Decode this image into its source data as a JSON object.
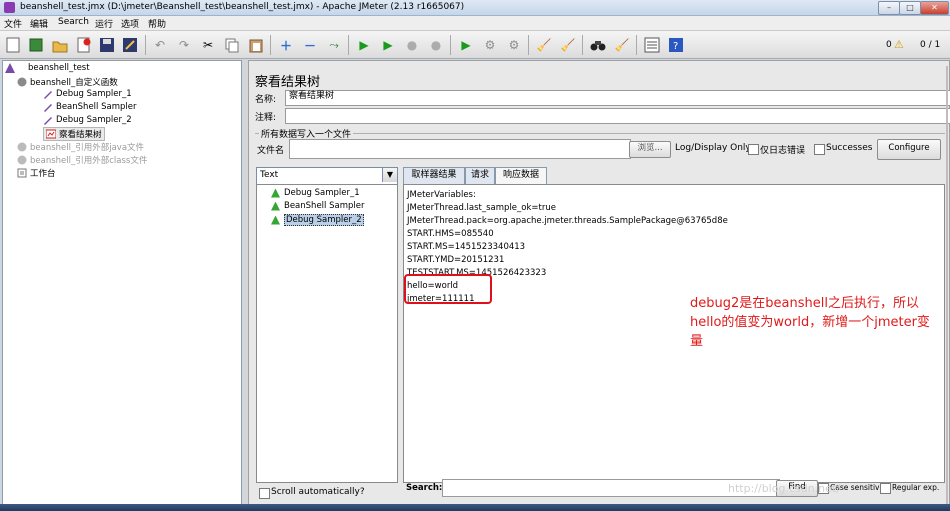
{
  "window": {
    "title": "beanshell_test.jmx (D:\\jmeter\\Beanshell_test\\beanshell_test.jmx) - Apache JMeter (2.13 r1665067)",
    "min_glyph": "–",
    "max_glyph": "□",
    "close_glyph": "✕"
  },
  "menu": [
    "文件",
    "编辑",
    "Search",
    "运行",
    "选项",
    "帮助"
  ],
  "toolbar": {
    "error_count": "0",
    "thread_count": "0 / 1"
  },
  "tree": {
    "items": [
      {
        "label": "beanshell_test",
        "grey": false
      },
      {
        "label": "beanshell_自定义函数",
        "grey": false
      },
      {
        "label": "Debug Sampler_1",
        "grey": false
      },
      {
        "label": "BeanShell Sampler",
        "grey": false
      },
      {
        "label": "Debug Sampler_2",
        "grey": false
      },
      {
        "label": "察看结果树",
        "grey": false
      },
      {
        "label": "beanshell_引用外部java文件",
        "grey": true
      },
      {
        "label": "beanshell_引用外部class文件",
        "grey": true
      },
      {
        "label": "工作台",
        "grey": false
      }
    ]
  },
  "panel": {
    "title": "察看结果树",
    "name_label": "名称:",
    "name_value": "察看结果树",
    "comment_label": "注释:",
    "comment_value": "",
    "group_label": "所有数据写入一个文件",
    "filename_label": "文件名",
    "filename_value": "",
    "browse_label": "浏览...",
    "log_display_label": "Log/Display Only:",
    "errors_only_label": "仅日志错误",
    "successes_label": "Successes",
    "configure_label": "Configure"
  },
  "results": {
    "renderer": "Text",
    "items": [
      "Debug Sampler_1",
      "BeanShell Sampler",
      "Debug Sampler_2"
    ],
    "selected": "Debug Sampler_2",
    "scroll_label": "Scroll automatically?"
  },
  "tabs": [
    "取样器结果",
    "请求",
    "响应数据"
  ],
  "response_lines": [
    "JMeterVariables:",
    "JMeterThread.last_sample_ok=true",
    "JMeterThread.pack=org.apache.jmeter.threads.SamplePackage@63765d8e",
    "START.HMS=085540",
    "START.MS=1451523340413",
    "START.YMD=20151231",
    "TESTSTART.MS=1451526423323",
    "hello=world",
    "jmeter=111111"
  ],
  "annotation": "debug2是在beanshell之后执行，所以hello的值变为world，新增一个jmeter变量",
  "search": {
    "label": "Search:",
    "value": "",
    "find_label": "Find",
    "case_label": "Case sensitive",
    "regex_label": "Regular exp."
  },
  "watermark": "http://blog.csdn.net/",
  "colors": {
    "annotation": "#e01a1a",
    "highlight": "#e0101a"
  }
}
